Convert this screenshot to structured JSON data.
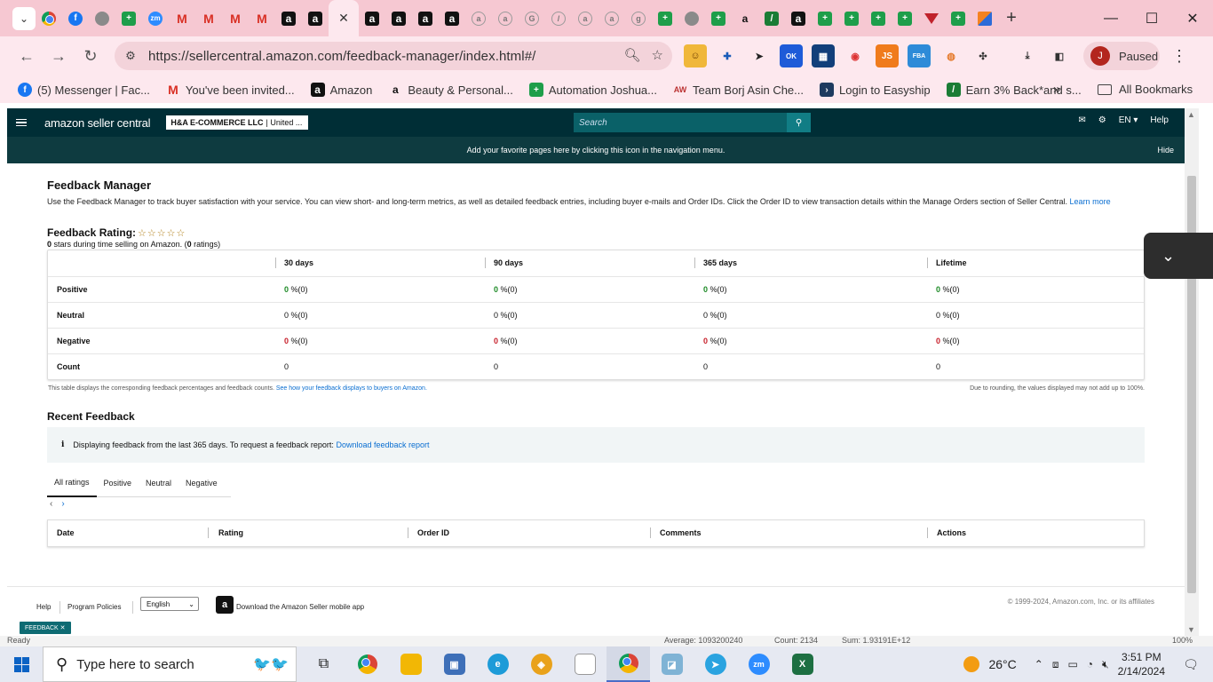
{
  "browser": {
    "url": "https://sellercentral.amazon.com/feedback-manager/index.html#/",
    "profile_label": "Paused",
    "profile_initial": "J",
    "bookmarks": [
      {
        "label": "(5) Messenger | Fac...",
        "icon": "messenger-icon"
      },
      {
        "label": "You've been invited...",
        "icon": "gmail-icon"
      },
      {
        "label": "Amazon",
        "icon": "amazon-icon"
      },
      {
        "label": "Beauty & Personal...",
        "icon": "amazon-icon"
      },
      {
        "label": "Automation Joshua...",
        "icon": "sheets-icon"
      },
      {
        "label": "Team Borj Asin Che...",
        "icon": "team-icon"
      },
      {
        "label": "Login to Easyship",
        "icon": "easyship-icon"
      },
      {
        "label": "Earn 3% Back*and s...",
        "icon": "cashback-icon"
      }
    ],
    "all_bookmarks": "All Bookmarks"
  },
  "seller_central": {
    "logo": "amazon seller central",
    "account": "H&A E-COMMERCE LLC",
    "account_suffix": "| United ...",
    "search_placeholder": "Search",
    "lang": "EN",
    "help": "Help",
    "banner": "Add your favorite pages here by clicking this icon  in the navigation menu.",
    "banner_hide": "Hide"
  },
  "feedback": {
    "title": "Feedback Manager",
    "intro": "Use the Feedback Manager to track buyer satisfaction with your service. You can view short- and long-term metrics, as well as detailed feedback entries, including buyer e-mails and Order IDs. Click the Order ID to view transaction details within the Manage Orders section of Seller Central.",
    "learn_more": "Learn more",
    "rating_label": "Feedback Rating:",
    "stars": "☆☆☆☆☆",
    "rating_stars": "0",
    "rating_mid": " stars during time selling on Amazon. (",
    "rating_count": "0",
    "rating_end": " ratings)",
    "columns": [
      "30 days",
      "90 days",
      "365 days",
      "Lifetime"
    ],
    "rows": [
      {
        "label": "Positive",
        "values": [
          "0",
          "0",
          "0",
          "0"
        ],
        "suffix": "%(0)"
      },
      {
        "label": "Neutral",
        "values": [
          "0",
          "0",
          "0",
          "0"
        ],
        "suffix": "%(0)"
      },
      {
        "label": "Negative",
        "values": [
          "0",
          "0",
          "0",
          "0"
        ],
        "suffix": "%(0)"
      },
      {
        "label": "Count",
        "values": [
          "0",
          "0",
          "0",
          "0"
        ],
        "suffix": ""
      }
    ],
    "note_left": "This table displays the corresponding feedback percentages and feedback counts.",
    "note_left_link": "See how your feedback displays to buyers on Amazon.",
    "note_right": "Due to rounding, the values displayed may not add up to 100%."
  },
  "recent": {
    "title": "Recent Feedback",
    "info_text": "Displaying feedback from the last 365 days. To request a feedback report:",
    "info_link": "Download feedback report",
    "tabs": [
      "All ratings",
      "Positive",
      "Neutral",
      "Negative"
    ],
    "columns": [
      "Date",
      "Rating",
      "Order ID",
      "Comments",
      "Actions"
    ]
  },
  "footer": {
    "help": "Help",
    "policies": "Program Policies",
    "language": "English",
    "app_text": "Download the Amazon Seller mobile app",
    "copyright": "© 1999-2024, Amazon.com, Inc. or its affiliates",
    "feedback_badge": "FEEDBACK ✕"
  },
  "excel_status": {
    "ready": "Ready",
    "average": "Average: 1093200240",
    "count": "Count: 2134",
    "sum": "Sum: 1.93191E+12",
    "zoom": "100%"
  },
  "taskbar": {
    "search_placeholder": "Type here to search",
    "temperature": "26°C",
    "time": "3:51 PM",
    "date": "2/14/2024"
  },
  "colors": {
    "header_bg": "#002e36",
    "accent_link": "#0a6ed1",
    "positive": "#1d8a26",
    "negative": "#c7202b"
  }
}
